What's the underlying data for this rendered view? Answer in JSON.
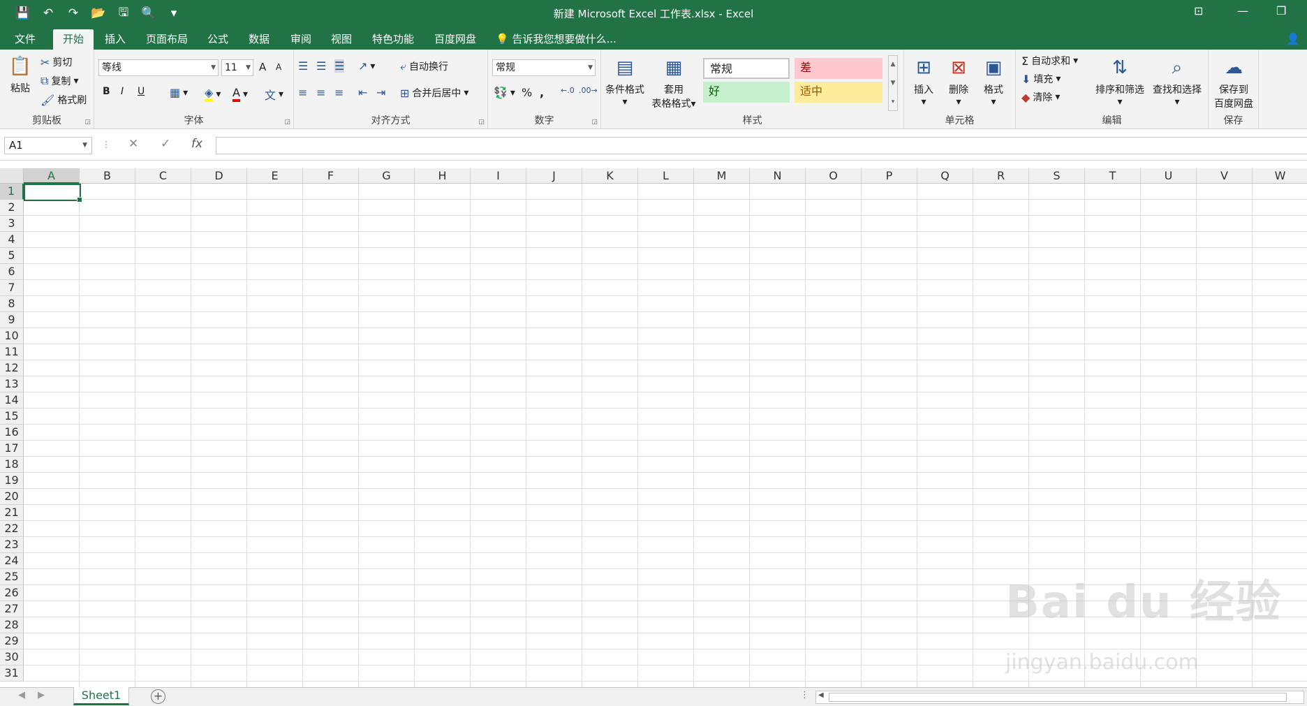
{
  "window": {
    "title": "新建 Microsoft Excel 工作表.xlsx - Excel"
  },
  "qat": {
    "save": "💾",
    "undo": "↶",
    "redo": "↷",
    "open": "📂",
    "print": "🖫",
    "preview": "🔍",
    "more": "▾"
  },
  "tabs": [
    "文件",
    "开始",
    "插入",
    "页面布局",
    "公式",
    "数据",
    "审阅",
    "视图",
    "特色功能",
    "百度网盘"
  ],
  "active_tab": "开始",
  "tellme": "告诉我您想要做什么...",
  "ribbon": {
    "clipboard": {
      "paste": "粘贴",
      "cut": "剪切",
      "copy": "复制",
      "format_painter": "格式刷",
      "name": "剪贴板"
    },
    "font": {
      "family": "等线",
      "size": "11",
      "bold": "B",
      "italic": "I",
      "underline": "U",
      "grow": "A",
      "shrink": "A",
      "name": "字体"
    },
    "alignment": {
      "wrap": "自动换行",
      "merge": "合并后居中",
      "name": "对齐方式"
    },
    "number": {
      "format": "常规",
      "percent": "%",
      "comma": ",",
      "name": "数字"
    },
    "styles": {
      "cond_format": "条件格式",
      "table_format_1": "套用",
      "table_format_2": "表格格式",
      "normal": "常规",
      "bad": "差",
      "good": "好",
      "neutral": "适中",
      "name": "样式"
    },
    "cells": {
      "insert": "插入",
      "delete": "删除",
      "format": "格式",
      "name": "单元格"
    },
    "editing": {
      "autosum": "自动求和",
      "fill": "填充",
      "clear": "清除",
      "sort": "排序和筛选",
      "find": "查找和选择",
      "name": "编辑"
    },
    "save": {
      "label_1": "保存到",
      "label_2": "百度网盘",
      "name": "保存"
    }
  },
  "formula_bar": {
    "name_box": "A1",
    "cancel": "✕",
    "enter": "✓",
    "fx": "fx",
    "value": ""
  },
  "columns": [
    "A",
    "B",
    "C",
    "D",
    "E",
    "F",
    "G",
    "H",
    "I",
    "J",
    "K",
    "L",
    "M",
    "N",
    "O",
    "P",
    "Q",
    "R",
    "S",
    "T",
    "U",
    "V",
    "W"
  ],
  "rows": [
    "1",
    "2",
    "3",
    "4",
    "5",
    "6",
    "7",
    "8",
    "9",
    "10",
    "11",
    "12",
    "13",
    "14",
    "15",
    "16",
    "17",
    "18",
    "19",
    "20",
    "21",
    "22",
    "23",
    "24",
    "25",
    "26",
    "27",
    "28",
    "29",
    "30",
    "31"
  ],
  "selected": {
    "column": "A",
    "row": "1"
  },
  "sheets": [
    "Sheet1"
  ],
  "watermark": {
    "text": "Bai du 经验",
    "url": "jingyan.baidu.com"
  },
  "colors": {
    "accent": "#217346",
    "bad_bg": "#ffc7ce",
    "bad_fg": "#9c0006",
    "good_bg": "#c6efce",
    "good_fg": "#006100",
    "neutral_bg": "#ffeb9c",
    "neutral_fg": "#9c5700"
  }
}
